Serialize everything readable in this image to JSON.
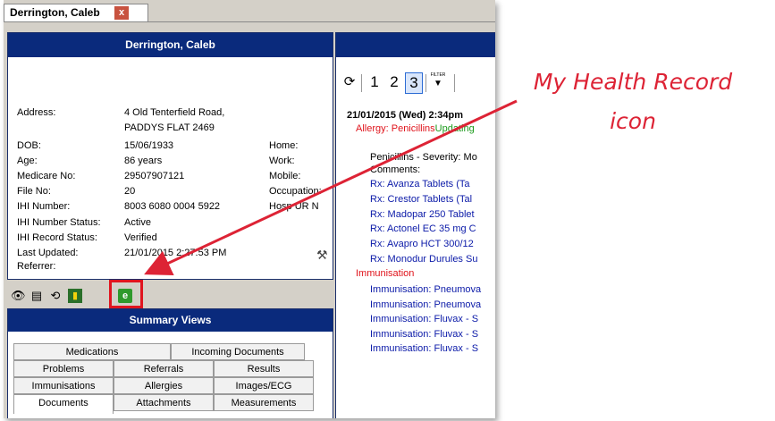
{
  "tab": {
    "title": "Derrington, Caleb",
    "close": "x"
  },
  "patient": {
    "header": "Derrington, Caleb",
    "fields": [
      {
        "label": "Address:",
        "value": "4 Old Tenterfield Road,"
      },
      {
        "label": "",
        "value": "PADDYS FLAT  2469"
      },
      {
        "label": "DOB:",
        "value": "15/06/1933"
      },
      {
        "label": "Age:",
        "value": "86 years"
      },
      {
        "label": "Medicare No:",
        "value": "29507907121"
      },
      {
        "label": "File No:",
        "value": "20"
      },
      {
        "label": "IHI Number:",
        "value": "8003 6080 0004 5922"
      },
      {
        "label": "IHI Number Status:",
        "value": "Active"
      },
      {
        "label": "IHI Record Status:",
        "value": "Verified"
      },
      {
        "label": "Last Updated:",
        "value": "21/01/2015 2:27:53 PM"
      },
      {
        "label": "Referrer:",
        "value": ""
      }
    ],
    "right_labels": [
      "Home:",
      "Work:",
      "Mobile:",
      "Occupation:",
      "Hosp UR N"
    ]
  },
  "icons": [
    "eye-icon",
    "document-icon",
    "history-icon",
    "card-icon",
    "my-health-record-icon"
  ],
  "summary": {
    "header": "Summary Views",
    "tabs_row1": [
      "Medications",
      "Incoming Documents"
    ],
    "tabs_row2": [
      "Problems",
      "Referrals",
      "Results"
    ],
    "tabs_row3": [
      "Immunisations",
      "Allergies",
      "Images/ECG"
    ],
    "tabs_row4": [
      "Documents",
      "Attachments",
      "Measurements"
    ]
  },
  "toolbar": {
    "pages": [
      "1",
      "2",
      "3"
    ],
    "filter": "FILTER"
  },
  "clinical": {
    "date_line": "21/01/2015 (Wed) 2:34pm",
    "allergy_prefix": "Allergy: Penicillins",
    "allergy_status": "Updating",
    "lines": [
      "Penicillins - Severity: Mo",
      "Comments:",
      "Rx: Avanza Tablets (Ta",
      "Rx: Crestor Tablets (Tal",
      "Rx: Madopar 250 Tablet",
      "Rx: Actonel EC 35 mg C",
      "Rx: Avapro HCT 300/12",
      "Rx: Monodur Durules Su"
    ],
    "immunisation_heading": "Immunisation",
    "immunisations": [
      "Immunisation: Pneumova",
      "Immunisation: Pneumova",
      "Immunisation: Fluvax - S",
      "Immunisation: Fluvax - S",
      "Immunisation: Fluvax - S"
    ]
  },
  "annotation": {
    "line1": "My Health Record",
    "line2": "icon",
    "color": "#dd2335"
  }
}
